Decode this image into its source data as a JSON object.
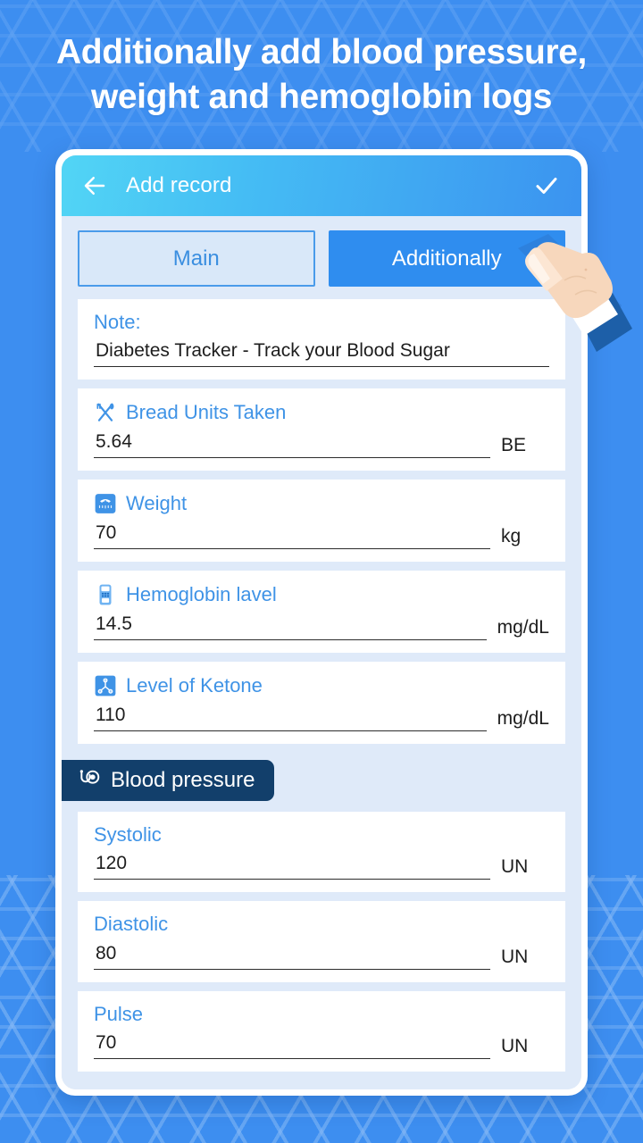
{
  "headline": {
    "line1": "Additionally add blood pressure,",
    "line2": "weight and hemoglobin logs"
  },
  "colors": {
    "page_background": "#3d8ef0",
    "appbar_gradient_start": "#52d5f5",
    "appbar_gradient_end": "#3b93f0",
    "accent_blue": "#3f93e6",
    "active_tab": "#2f8def",
    "badge_navy": "#123f6b",
    "screen_background": "#dfeaf9"
  },
  "appbar": {
    "back_icon": "arrow-left-icon",
    "title": "Add record",
    "confirm_icon": "check-icon"
  },
  "tabs": [
    {
      "label": "Main",
      "active": false
    },
    {
      "label": "Additionally",
      "active": true
    }
  ],
  "fields": [
    {
      "label": "Note:",
      "icon": null,
      "value": "Diabetes Tracker - Track your Blood Sugar",
      "placeholder": "",
      "unit": ""
    },
    {
      "label": "Bread Units Taken",
      "icon": "fork-knife-icon",
      "value": "5.64",
      "placeholder": "",
      "unit": "BE"
    },
    {
      "label": "Weight",
      "icon": "scale-icon",
      "value": "70",
      "placeholder": "",
      "unit": "kg"
    },
    {
      "label": "Hemoglobin lavel",
      "icon": "glucometer-icon",
      "value": "14.5",
      "placeholder": "",
      "unit": "mg/dL"
    },
    {
      "label": "Level of Ketone",
      "icon": "molecule-icon",
      "value": "110",
      "placeholder": "",
      "unit": "mg/dL"
    }
  ],
  "blood_pressure": {
    "badge_label": "Blood pressure",
    "badge_icon": "blood-pressure-monitor-icon",
    "fields": [
      {
        "label": "Systolic",
        "value": "120",
        "placeholder": "",
        "unit": "UN"
      },
      {
        "label": "Diastolic",
        "value": "80",
        "placeholder": "",
        "unit": "UN"
      },
      {
        "label": "Pulse",
        "value": "70",
        "placeholder": "",
        "unit": "UN"
      }
    ]
  },
  "pointer": {
    "icon": "pointing-hand-icon",
    "target": "Additionally"
  }
}
